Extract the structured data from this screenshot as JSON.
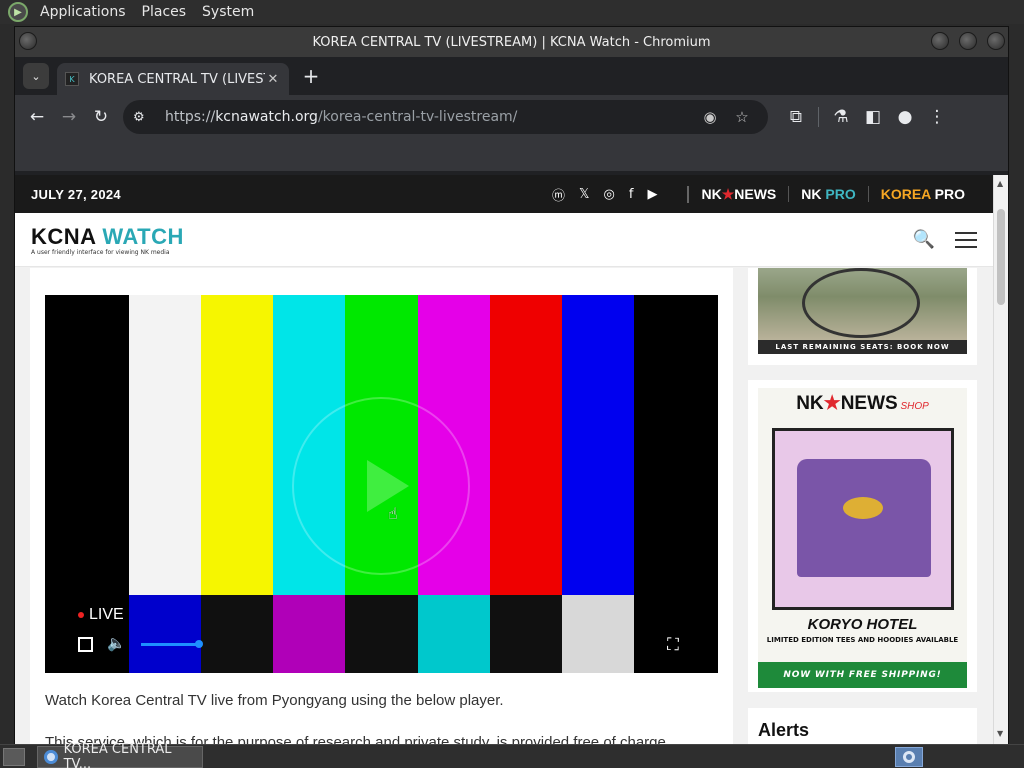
{
  "top_panel": {
    "items": [
      "Applications",
      "Places",
      "System"
    ]
  },
  "window": {
    "title": "KOREA CENTRAL TV (LIVESTREAM) | KCNA Watch - Chromium"
  },
  "tabs": [
    {
      "label": "KOREA CENTRAL TV (LIVEST",
      "favicon_text": "K"
    }
  ],
  "toolbar": {
    "back_icon": "←",
    "forward_icon": "→",
    "reload_icon": "↻",
    "site_info_icon": "⚙",
    "url_scheme": "https://",
    "url_host": "kcnawatch.org",
    "url_path": "/korea-central-tv-livestream/",
    "tracking_icon": "◉",
    "bookmark_icon": "☆",
    "extensions_icon": "⧉",
    "labs_icon": "⚗",
    "sidepanel_icon": "◧",
    "profile_icon": "●",
    "menu_icon": "⋮",
    "new_tab_icon": "+",
    "tab_close_icon": "✕",
    "tab_search_icon": "⌄"
  },
  "site": {
    "date": "JULY 27, 2024",
    "socials": [
      "ⓜ",
      "𝕏",
      "◎",
      "f",
      "▶"
    ],
    "brands": {
      "nk_news_a": "NK",
      "nk_news_star": "★",
      "nk_news_b": "NEWS",
      "nk_pro_a": "NK ",
      "nk_pro_b": "PRO",
      "korea_pro_a": "KOREA ",
      "korea_pro_b": "PRO"
    },
    "logo_main": "KCNA ",
    "logo_accent": "WATCH",
    "logo_tagline": "A user friendly interface for viewing NK media",
    "search_icon": "🔍"
  },
  "video": {
    "live_label": "LIVE",
    "volume_icon": "🔈",
    "fullscreen_icon": "⛶",
    "volume_level": 0.95,
    "bars_top": [
      "#f3f3f3",
      "#f6f600",
      "#00e5e8",
      "#00e800",
      "#e500e8",
      "#ef0000",
      "#0000ef"
    ],
    "bars_bottom": [
      "#0000cc",
      "#101010",
      "#b000b8",
      "#101010",
      "#00c8cc",
      "#101010",
      "#d8d8d8"
    ]
  },
  "article": {
    "intro": "Watch Korea Central TV live from Pyongyang using the below player.",
    "service_note": "This service, which is for the purpose of research and private study, is provided free of charge."
  },
  "sidebar": {
    "ad1_cta": "LAST REMAINING SEATS: BOOK NOW",
    "ad2_brand_a": "NK",
    "ad2_brand_star": "★",
    "ad2_brand_b": "NEWS",
    "ad2_shop": " SHOP",
    "ad2_title": "KORYO HOTEL",
    "ad2_sub": "LIMITED EDITION TEES AND HOODIES AVAILABLE",
    "ad2_ship": "NOW WITH FREE SHIPPING!",
    "alerts_title": "Alerts"
  },
  "taskbar": {
    "task_label": "KOREA CENTRAL TV..."
  }
}
